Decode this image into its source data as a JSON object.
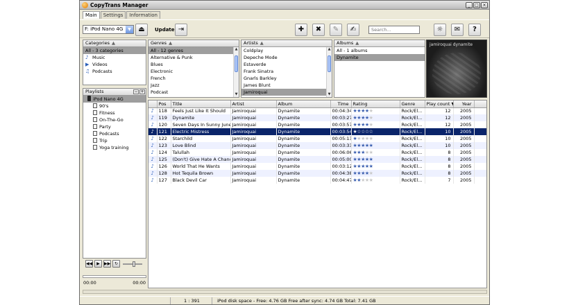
{
  "window": {
    "title": "CopyTrans Manager"
  },
  "tabs": [
    "Main",
    "Settings",
    "Information"
  ],
  "toolbar": {
    "device": "F: iPod Nano 4G",
    "update_label": "Update",
    "search_placeholder": "Search..."
  },
  "categories": {
    "header": "Categories",
    "items": [
      "All - 3 categories",
      "Music",
      "Videos",
      "Podcasts"
    ]
  },
  "genres": {
    "header": "Genres",
    "items": [
      "All - 12 genres",
      "Alternative & Punk",
      "Blues",
      "Electronic",
      "French",
      "Jazz",
      "Podcast"
    ]
  },
  "artists": {
    "header": "Artists",
    "items": [
      "Coldplay",
      "Depeche Mode",
      "Estaverde",
      "Frank Sinatra",
      "Gnarls Barkley",
      "James Blunt",
      "Jamiroquai"
    ]
  },
  "albums": {
    "header": "Albums",
    "items": [
      "All - 1 albums",
      "Dynamite"
    ]
  },
  "album_art": {
    "text": "jamiroquai dynamite"
  },
  "playlists": {
    "header": "Playlists",
    "device": "iPod Nano 4G",
    "items": [
      "90's",
      "Fitness",
      "On-The-Go",
      "Party",
      "Podcasts",
      "Trip",
      "Yoga training"
    ]
  },
  "player": {
    "elapsed": "00:00",
    "total": "00:00",
    "volume": 0.5
  },
  "tracks": {
    "columns": [
      "Pos",
      "Title",
      "Artist",
      "Album",
      "Time",
      "Rating",
      "Genre",
      "Play count",
      "Year"
    ],
    "rows": [
      {
        "pos": "118",
        "title": "Feels Just Like It Should",
        "artist": "Jamiroquai",
        "album": "Dynamite",
        "time": "00:04:34",
        "rating": 4,
        "genre": "Rock/El...",
        "plays": "12",
        "year": "2005"
      },
      {
        "pos": "119",
        "title": "Dynamite",
        "artist": "Jamiroquai",
        "album": "Dynamite",
        "time": "00:03:27",
        "rating": 4,
        "genre": "Rock/El...",
        "plays": "12",
        "year": "2005"
      },
      {
        "pos": "120",
        "title": "Seven Days In Sunny June",
        "artist": "Jamiroquai",
        "album": "Dynamite",
        "time": "00:03:57",
        "rating": 4,
        "genre": "Rock/El...",
        "plays": "12",
        "year": "2005"
      },
      {
        "pos": "121",
        "title": "Electric Mistress",
        "artist": "Jamiroquai",
        "album": "Dynamite",
        "time": "00:03:54",
        "rating": 1,
        "genre": "Rock/El...",
        "plays": "10",
        "year": "2005"
      },
      {
        "pos": "122",
        "title": "Starchild",
        "artist": "Jamiroquai",
        "album": "Dynamite",
        "time": "00:05:13",
        "rating": 1,
        "genre": "Rock/El...",
        "plays": "10",
        "year": "2005"
      },
      {
        "pos": "123",
        "title": "Love Blind",
        "artist": "Jamiroquai",
        "album": "Dynamite",
        "time": "00:03:33",
        "rating": 5,
        "genre": "Rock/El...",
        "plays": "10",
        "year": "2005"
      },
      {
        "pos": "124",
        "title": "Talullah",
        "artist": "Jamiroquai",
        "album": "Dynamite",
        "time": "00:06:06",
        "rating": 3,
        "genre": "Rock/El...",
        "plays": "8",
        "year": "2005"
      },
      {
        "pos": "125",
        "title": "(Don't) Give Hate A Chance",
        "artist": "Jamiroquai",
        "album": "Dynamite",
        "time": "00:05:00",
        "rating": 5,
        "genre": "Rock/El...",
        "plays": "8",
        "year": "2005"
      },
      {
        "pos": "126",
        "title": "World That He Wants",
        "artist": "Jamiroquai",
        "album": "Dynamite",
        "time": "00:03:12",
        "rating": 5,
        "genre": "Rock/El...",
        "plays": "8",
        "year": "2005"
      },
      {
        "pos": "128",
        "title": "Hot Tequila Brown",
        "artist": "Jamiroquai",
        "album": "Dynamite",
        "time": "00:04:38",
        "rating": 4,
        "genre": "Rock/El...",
        "plays": "8",
        "year": "2005"
      },
      {
        "pos": "127",
        "title": "Black Devil Car",
        "artist": "Jamiroquai",
        "album": "Dynamite",
        "time": "00:04:47",
        "rating": 2,
        "genre": "Rock/El...",
        "plays": "7",
        "year": "2005"
      }
    ],
    "selected_index": 3
  },
  "status": {
    "count": "1 : 391",
    "disk": "iPod disk space - Free: 4.76 GB Free after sync: 4.74 GB Total: 7.41 GB"
  }
}
